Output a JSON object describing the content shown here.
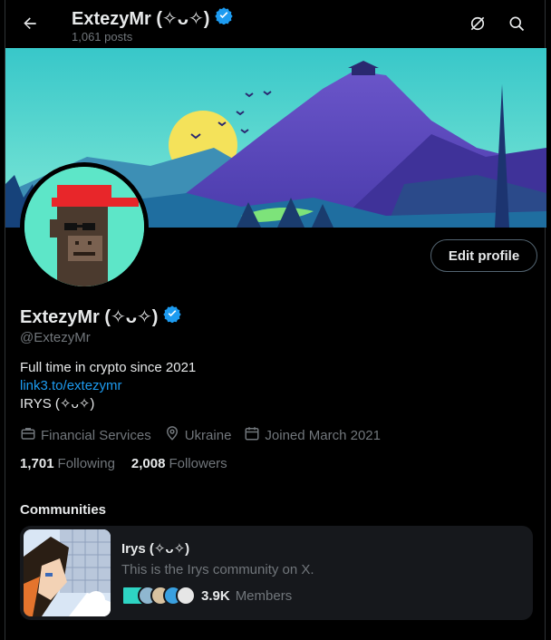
{
  "header": {
    "title": "ExtezyMr (✧ᴗ✧)",
    "posts": "1,061 posts"
  },
  "profile": {
    "display_name": "ExtezyMr (✧ᴗ✧)",
    "handle": "@ExtezyMr",
    "bio_line1": "Full time in crypto since 2021",
    "bio_link": "link3.to/extezymr",
    "bio_line3": "IRYS (✧ᴗ✧)",
    "edit_label": "Edit profile",
    "category": "Financial Services",
    "location": "Ukraine",
    "joined": "Joined March 2021",
    "following_count": "1,701",
    "following_label": "Following",
    "followers_count": "2,008",
    "followers_label": "Followers"
  },
  "communities": {
    "title": "Communities",
    "items": [
      {
        "name": "Irys (✧ᴗ✧)",
        "description": "This is the Irys community on X.",
        "members_count": "3.9K",
        "members_label": "Members"
      }
    ]
  },
  "colors": {
    "accent": "#1d9bf0",
    "verified": "#1d9bf0",
    "avatar_bg": "#5de6c8"
  },
  "icons": [
    "back-arrow-icon",
    "verified-badge-icon",
    "grok-icon",
    "search-icon",
    "briefcase-icon",
    "location-pin-icon",
    "calendar-icon"
  ]
}
